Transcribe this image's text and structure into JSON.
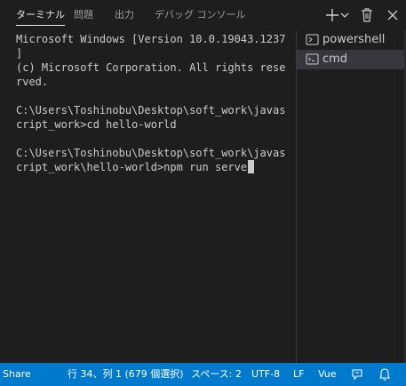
{
  "panel": {
    "tabs": [
      {
        "label": "ターミナル",
        "active": true
      },
      {
        "label": "問題",
        "active": false
      },
      {
        "label": "出力",
        "active": false
      },
      {
        "label": "デバッグ コンソール",
        "active": false
      }
    ],
    "actions": [
      "plus-icon",
      "chevron-down-icon",
      "trash-icon",
      "chevron-up-icon",
      "close-icon"
    ]
  },
  "terminal": {
    "lines": [
      "Microsoft Windows [Version 10.0.19043.1237",
      "]",
      "(c) Microsoft Corporation. All rights rese",
      "rved.",
      "",
      "C:\\Users\\Toshinobu\\Desktop\\soft_work\\javas",
      "cript_work>cd hello-world",
      "",
      "C:\\Users\\Toshinobu\\Desktop\\soft_work\\javas",
      "cript_work\\hello-world>npm run serve"
    ]
  },
  "terminal_list": {
    "items": [
      {
        "label": "powershell",
        "icon": "terminal-icon",
        "selected": false
      },
      {
        "label": "cmd",
        "icon": "terminal-cmd-icon",
        "selected": true
      }
    ]
  },
  "statusbar": {
    "share": "Share",
    "position": "行 34、列 1 (679 個選択)",
    "spaces": "スペース: 2",
    "encoding": "UTF-8",
    "eol": "LF",
    "language": "Vue",
    "icons": [
      "feedback-icon",
      "bell-icon"
    ]
  },
  "colors": {
    "background": "#1e1e1e",
    "statusbar": "#007acc",
    "selected_item": "#37373d",
    "text": "#cccccc"
  }
}
